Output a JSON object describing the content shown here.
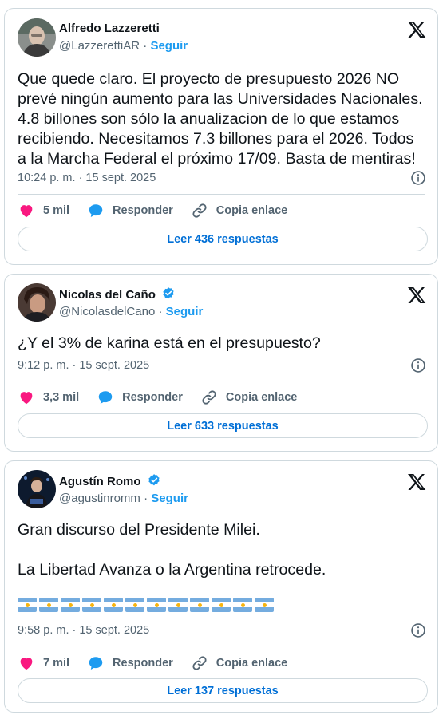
{
  "posts": [
    {
      "name": "Alfredo Lazzeretti",
      "handle": "@LazzerettiAR",
      "separator": "·",
      "follow": "Seguir",
      "verified": false,
      "text": "Que quede claro. El proyecto de presupuesto 2026 NO prevé ningún aumento para las Universidades Nacionales. 4.8 billones son sólo la anualizacion de lo que estamos recibiendo.  Necesitamos 7.3 billones para el 2026. Todos a la Marcha Federal el próximo 17/09. Basta de mentiras!",
      "timestamp": "10:24 p. m. · 15 sept. 2025",
      "likes": "5 mil",
      "reply_label": "Responder",
      "copy_label": "Copia enlace",
      "read_label": "Leer 436 respuestas"
    },
    {
      "name": "Nicolas del Caño",
      "handle": "@NicolasdelCano",
      "separator": "·",
      "follow": "Seguir",
      "verified": true,
      "text": "¿Y el 3% de karina está en el presupuesto?",
      "timestamp": "9:12 p. m. · 15 sept. 2025",
      "likes": "3,3 mil",
      "reply_label": "Responder",
      "copy_label": "Copia enlace",
      "read_label": "Leer 633 respuestas"
    },
    {
      "name": "Agustín Romo",
      "handle": "@agustinromm",
      "separator": "·",
      "follow": "Seguir",
      "verified": true,
      "text": "Gran discurso del Presidente Milei.",
      "text2": "La Libertad Avanza o la Argentina retrocede.",
      "flag_count": 12,
      "timestamp": "9:58 p. m. · 15 sept. 2025",
      "likes": "7 mil",
      "reply_label": "Responder",
      "copy_label": "Copia enlace",
      "read_label": "Leer 137 respuestas"
    }
  ],
  "colors": {
    "like": "#f91880",
    "reply": "#1d9bf0",
    "link": "#006fd6",
    "follow": "#1d9bf0",
    "muted": "#536471",
    "border": "#cfd9de"
  },
  "icons": [
    "x-logo-icon",
    "verified-badge-icon",
    "info-icon",
    "heart-icon",
    "reply-bubble-icon",
    "link-icon",
    "argentina-flag-emoji"
  ]
}
